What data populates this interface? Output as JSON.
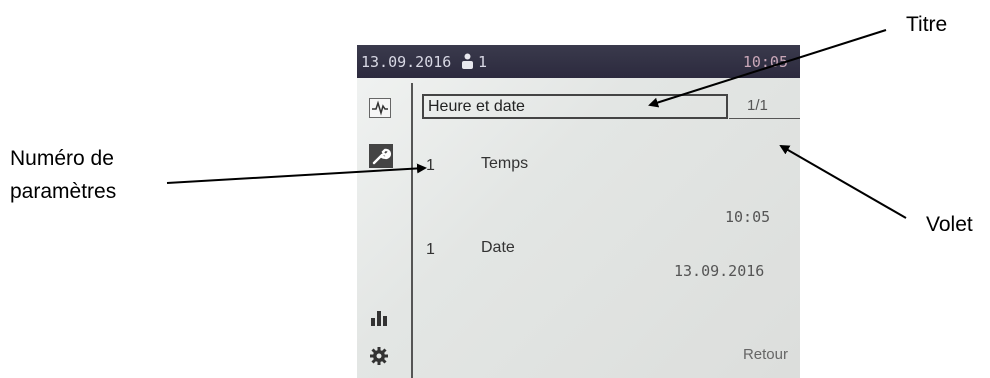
{
  "annotations": {
    "titre": "Titre",
    "volet": "Volet",
    "numero_line1": "Numéro de",
    "numero_line2": "paramètres"
  },
  "status_bar": {
    "date": "13.09.2016",
    "user_count": "1",
    "time": "10:05"
  },
  "sidebar": {
    "icons": [
      "pulse-icon",
      "wrench-icon",
      "bar-chart-icon",
      "gear-icon"
    ],
    "active_index": 1
  },
  "screen": {
    "title": "Heure et date",
    "page_indicator": "1/1",
    "rows": [
      {
        "number": "1",
        "label": "Temps",
        "value": "10:05"
      },
      {
        "number": "1",
        "label": "Date",
        "value": "13.09.2016"
      }
    ],
    "back_label": "Retour"
  },
  "colors": {
    "status_bar_bg": "#2c2a3e",
    "screen_bg": "#e3e6e4",
    "arrow": "#000000"
  }
}
